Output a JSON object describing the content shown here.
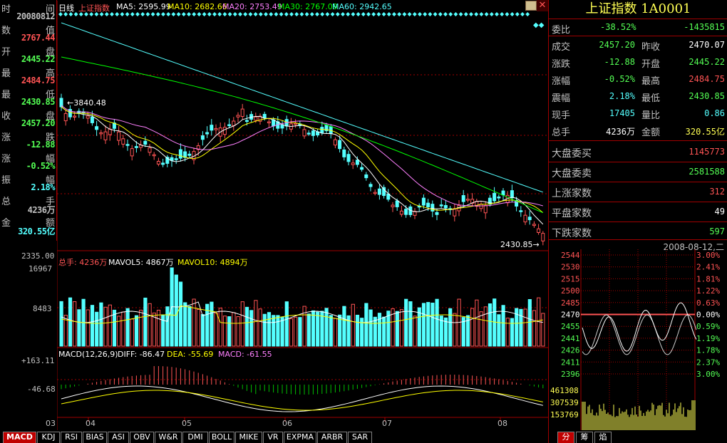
{
  "left_panel": {
    "rows": [
      {
        "label": "时间",
        "value": "20080812"
      },
      {
        "label": "数值",
        "value": "2767.44"
      },
      {
        "label": "开盘",
        "value": "2445.22"
      },
      {
        "label": "最高",
        "value": "2484.75"
      },
      {
        "label": "最低",
        "value": "2430.85"
      },
      {
        "label": "收盘",
        "value": "2457.20"
      },
      {
        "label": "涨跌",
        "value": "-12.88"
      },
      {
        "label": "涨幅",
        "value": "-0.52%"
      },
      {
        "label": "振幅",
        "value": "2.18%"
      },
      {
        "label": "总手",
        "value": "4236万"
      },
      {
        "label": "金额",
        "value": "320.55亿"
      }
    ]
  },
  "main_chart": {
    "period": "日线",
    "index_name": "上证指数",
    "ma5": "MA5: 2595.99",
    "ma10": "MA10: 2682.66",
    "ma20": "MA20: 2753.49",
    "ma30": "MA30: 2767.09",
    "ma60": "MA60: 2942.65",
    "high_label": "3840.48",
    "low_label": "2430.85",
    "axis_price_low": "2335.00"
  },
  "volume_panel": {
    "total": "总手: 4236万",
    "mavol5": "MAVOL5: 4867万",
    "mavol10": "MAVOL10: 4894万",
    "axis_top": "16967",
    "axis_mid": "8483"
  },
  "macd_panel": {
    "title": "MACD(12,26,9)",
    "diff": "DIFF: -86.47",
    "dea": "DEA: -55.69",
    "macd": "MACD: -61.55",
    "axis_top": "+163.11",
    "axis_mid": "-46.68"
  },
  "x_axis": {
    "labels": [
      "03",
      "04",
      "05",
      "06",
      "07",
      "08"
    ]
  },
  "tabs": [
    "MACD",
    "KDJ",
    "RSI",
    "BIAS",
    "ASI",
    "OBV",
    "W&R",
    "DMI",
    "BOLL",
    "MIKE",
    "VR",
    "EXPMA",
    "ARBR",
    "SAR"
  ],
  "right_panel": {
    "title": "上证指数 1A0001",
    "weibi": {
      "label": "委比",
      "pct": "-38.52%",
      "diff": "-1435815"
    },
    "quote_rows": [
      {
        "l1": "成交",
        "v1": "2457.20",
        "l2": "昨收",
        "v2": "2470.07"
      },
      {
        "l1": "涨跌",
        "v1": "-12.88",
        "l2": "开盘",
        "v2": "2445.22"
      },
      {
        "l1": "涨幅",
        "v1": "-0.52%",
        "l2": "最高",
        "v2": "2484.75"
      },
      {
        "l1": "震幅",
        "v1": "2.18%",
        "l2": "最低",
        "v2": "2430.85"
      },
      {
        "l1": "现手",
        "v1": "17405",
        "l2": "量比",
        "v2": "0.86"
      },
      {
        "l1": "总手",
        "v1": "4236万",
        "l2": "金额",
        "v2": "320.55亿"
      }
    ],
    "market_rows": [
      {
        "label": "大盘委买",
        "value": "1145773"
      },
      {
        "label": "大盘委卖",
        "value": "2581588"
      },
      {
        "label": "上涨家数",
        "value": "312"
      },
      {
        "label": "平盘家数",
        "value": "49"
      },
      {
        "label": "下跌家数",
        "value": "597"
      }
    ],
    "intraday": {
      "date": "2008-08-12,二",
      "left_axis": [
        "2544",
        "2530",
        "2515",
        "2500",
        "2485",
        "2470",
        "2455",
        "2441",
        "2426",
        "2411",
        "2396"
      ],
      "right_axis": [
        "3.00%",
        "2.41%",
        "1.81%",
        "1.22%",
        "0.63%",
        "0.00%",
        "0.59%",
        "1.19%",
        "1.78%",
        "2.37%",
        "3.00%"
      ],
      "vol_axis": [
        "461308",
        "307539",
        "153769"
      ]
    },
    "bottom_tabs": [
      "分",
      "筹",
      "焰"
    ]
  },
  "colors": {
    "up": "#ff5454",
    "down": "#54ffff",
    "ma5": "#ffffff",
    "ma10": "#ffff00",
    "ma20": "#ff80ff",
    "ma30": "#00ff00",
    "ma60": "#54ffff",
    "grid": "#a00000",
    "label": "#ffff54"
  }
}
